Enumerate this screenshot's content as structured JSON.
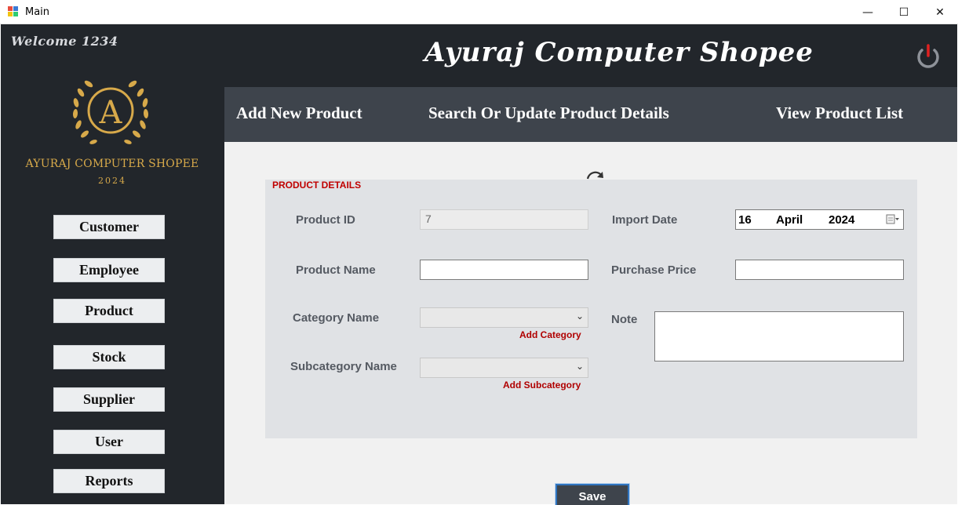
{
  "window": {
    "title": "Main",
    "minimize": "—",
    "maximize": "☐",
    "close": "✕"
  },
  "header": {
    "welcome": "Welcome 1234",
    "shop_title": "Ayuraj Computer Shopee"
  },
  "logo": {
    "letter": "A",
    "name": "AYURAJ COMPUTER SHOPEE",
    "year": "2024"
  },
  "sidebar": {
    "items": [
      {
        "label": "Customer"
      },
      {
        "label": "Employee"
      },
      {
        "label": "Product"
      },
      {
        "label": "Stock"
      },
      {
        "label": "Supplier"
      },
      {
        "label": "User"
      },
      {
        "label": "Reports"
      }
    ]
  },
  "tabs": [
    {
      "label": "Add New Product"
    },
    {
      "label": "Search Or Update Product Details"
    },
    {
      "label": "View Product List"
    }
  ],
  "form": {
    "panel_title": "PRODUCT DETAILS",
    "product_id_label": "Product ID",
    "product_id_value": "7",
    "product_name_label": "Product Name",
    "product_name_value": "",
    "category_label": "Category Name",
    "category_value": "",
    "add_category_link": "Add Category",
    "subcategory_label": "Subcategory Name",
    "subcategory_value": "",
    "add_subcategory_link": "Add Subcategory",
    "import_date_label": "Import Date",
    "import_date": {
      "day": "16",
      "month": "April",
      "year": "2024"
    },
    "purchase_price_label": "Purchase Price",
    "purchase_price_value": "",
    "note_label": "Note",
    "note_value": "",
    "save_label": "Save"
  },
  "colors": {
    "frame_dark": "#22262b",
    "tabbar": "#3e444c",
    "panel": "#e0e2e5",
    "gold": "#d7a94a",
    "accent_red": "#c00000",
    "power_red": "#e02020"
  },
  "icons": {
    "power": "power-icon",
    "refresh": "refresh-icon",
    "calendar": "calendar-icon",
    "chevron": "chevron-down-icon"
  }
}
